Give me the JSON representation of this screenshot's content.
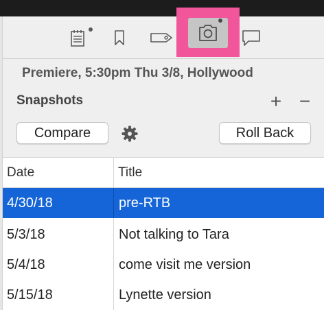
{
  "toolbar": {
    "icons": [
      "notes-icon",
      "bookmark-icon",
      "tag-icon",
      "camera-icon",
      "comment-icon"
    ],
    "active": "camera-icon",
    "highlight_color": "#f2569a"
  },
  "header": {
    "scene_title": "Premiere, 5:30pm Thu 3/8, Hollywood",
    "section_title": "Snapshots",
    "add_label": "+",
    "remove_label": "−"
  },
  "actions": {
    "compare_label": "Compare",
    "rollback_label": "Roll Back"
  },
  "table": {
    "columns": [
      "Date",
      "Title"
    ],
    "rows": [
      {
        "date": "4/30/18",
        "title": "pre-RTB",
        "selected": true
      },
      {
        "date": "5/3/18",
        "title": "Not talking to Tara",
        "selected": false
      },
      {
        "date": "5/4/18",
        "title": "come visit me version",
        "selected": false
      },
      {
        "date": "5/15/18",
        "title": "Lynette version",
        "selected": false
      }
    ],
    "selection_color": "#1565d8"
  }
}
